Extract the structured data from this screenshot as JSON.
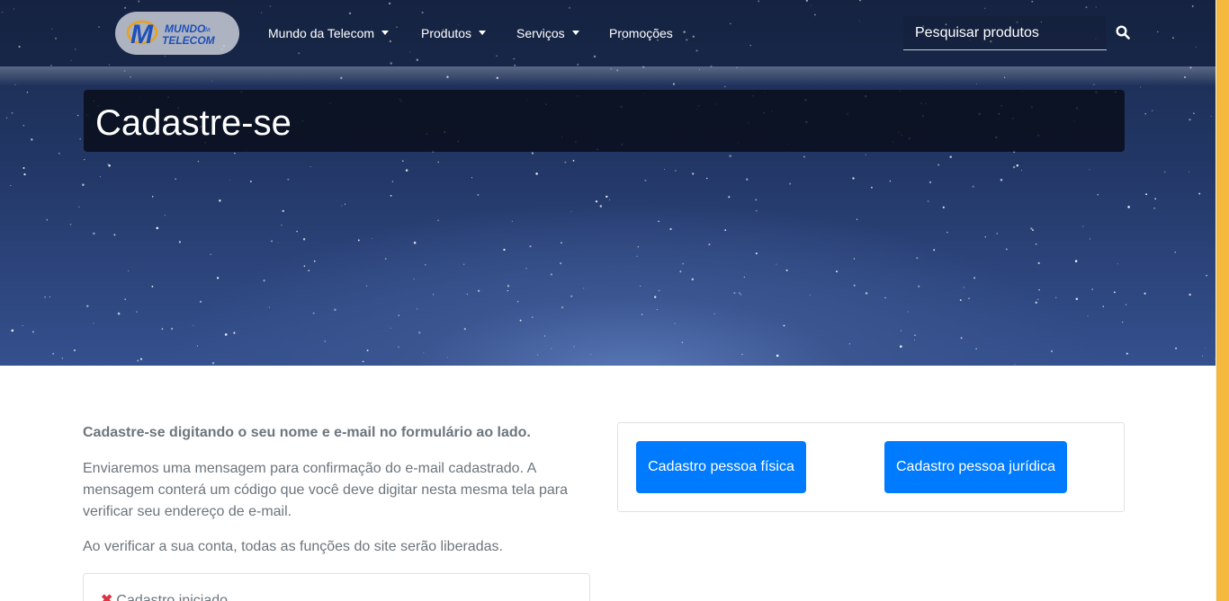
{
  "brand": {
    "logo_line1": "MUNDO",
    "logo_small": "da",
    "logo_line2": "TELECOM"
  },
  "nav": {
    "items": [
      {
        "label": "Mundo da Telecom",
        "has_dropdown": true
      },
      {
        "label": "Produtos",
        "has_dropdown": true
      },
      {
        "label": "Serviços",
        "has_dropdown": true
      },
      {
        "label": "Promoções",
        "has_dropdown": false
      }
    ],
    "search": {
      "placeholder": "Pesquisar produtos",
      "icon": "search-icon"
    }
  },
  "hero": {
    "title": "Cadastre-se"
  },
  "content": {
    "lead": "Cadastre-se digitando o seu nome e e-mail no formulário ao lado.",
    "paragraph1": "Enviaremos uma mensagem para confirmação do e-mail cadastrado. A mensagem conterá um código que você deve digitar nesta mesma tela para verificar seu endereço de e-mail.",
    "paragraph2": "Ao verificar a sua conta, todas as funções do site serão liberadas.",
    "status": {
      "mark": "✖",
      "label": "Cadastro iniciado"
    }
  },
  "actions": {
    "pessoa_fisica": "Cadastro pessoa física",
    "pessoa_juridica": "Cadastro pessoa jurídica"
  },
  "colors": {
    "primary": "#007bff",
    "scrollbar": "#f5b940",
    "text_muted": "#6c757d",
    "error": "#dc3545"
  }
}
